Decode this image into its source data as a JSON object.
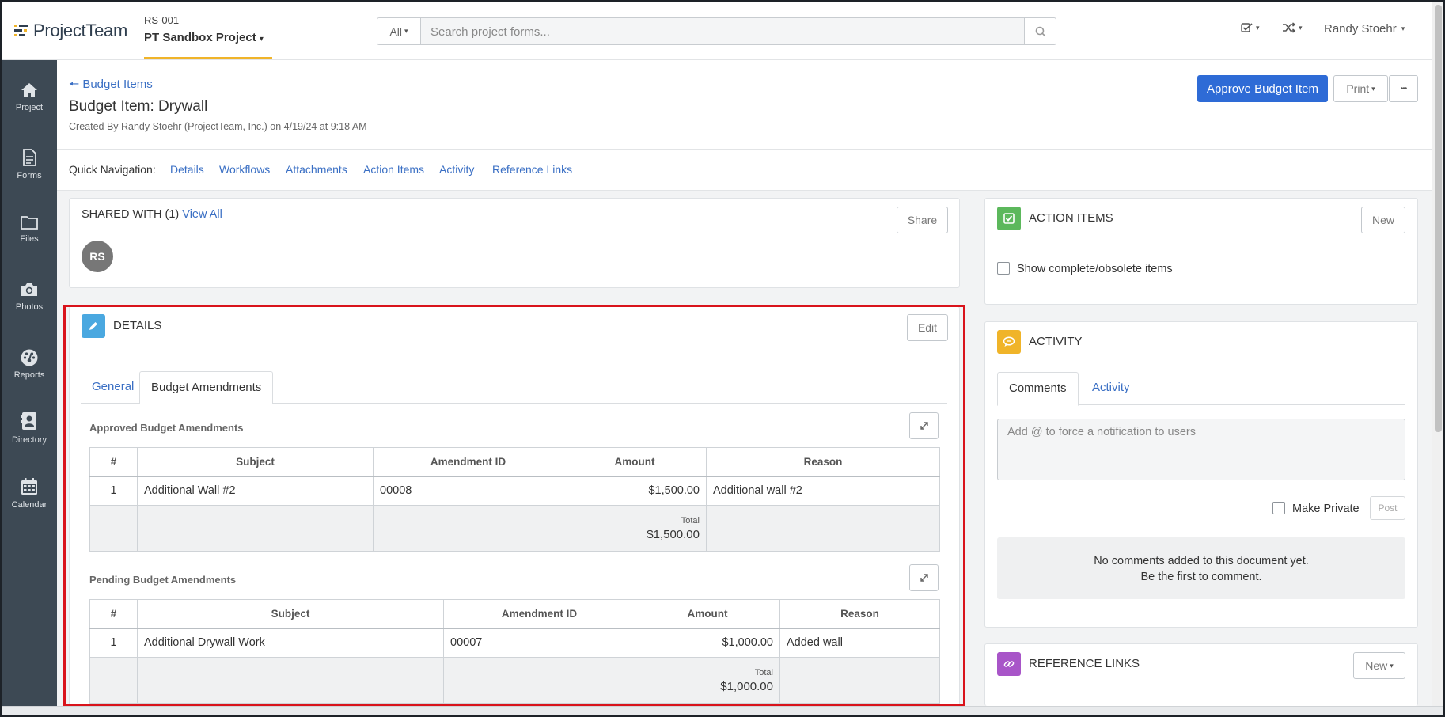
{
  "app": {
    "logo_text": "ProjectTeam",
    "project_code": "RS-001",
    "project_name": "PT Sandbox Project",
    "search_scope": "All",
    "search_placeholder": "Search project forms...",
    "user_name": "Randy Stoehr"
  },
  "sidebar": {
    "items": [
      {
        "label": "Project",
        "icon": "home-icon"
      },
      {
        "label": "Forms",
        "icon": "document-icon"
      },
      {
        "label": "Files",
        "icon": "folder-icon"
      },
      {
        "label": "Photos",
        "icon": "camera-icon"
      },
      {
        "label": "Reports",
        "icon": "dashboard-icon"
      },
      {
        "label": "Directory",
        "icon": "contact-book-icon"
      },
      {
        "label": "Calendar",
        "icon": "calendar-icon"
      }
    ]
  },
  "header": {
    "back_label": "Budget Items",
    "title": "Budget Item: Drywall",
    "created": "Created By Randy Stoehr (ProjectTeam, Inc.) on 4/19/24 at 9:18 AM",
    "approve_label": "Approve Budget Item",
    "print_label": "Print",
    "more_label": "•••"
  },
  "quicknav": {
    "label": "Quick Navigation:",
    "links": [
      "Details",
      "Workflows",
      "Attachments",
      "Action Items",
      "Activity",
      "Reference Links"
    ]
  },
  "shared": {
    "title": "SHARED WITH (1)",
    "view_all": "View All",
    "share_label": "Share",
    "avatar_initials": "RS"
  },
  "details": {
    "title": "DETAILS",
    "edit_label": "Edit",
    "tabs": [
      "General",
      "Budget Amendments"
    ],
    "columns": [
      "#",
      "Subject",
      "Amendment ID",
      "Amount",
      "Reason"
    ],
    "approved": {
      "title": "Approved Budget Amendments",
      "rows": [
        {
          "num": "1",
          "subject": "Additional Wall #2",
          "amendment_id": "00008",
          "amount": "$1,500.00",
          "reason": "Additional wall #2"
        }
      ],
      "total_label": "Total",
      "total_value": "$1,500.00"
    },
    "pending": {
      "title": "Pending Budget Amendments",
      "rows": [
        {
          "num": "1",
          "subject": "Additional Drywall Work",
          "amendment_id": "00007",
          "amount": "$1,000.00",
          "reason": "Added wall"
        }
      ],
      "total_label": "Total",
      "total_value": "$1,000.00"
    }
  },
  "action_items": {
    "title": "ACTION ITEMS",
    "new_label": "New",
    "show_complete_label": "Show complete/obsolete items"
  },
  "activity": {
    "title": "ACTIVITY",
    "tabs": [
      "Comments",
      "Activity"
    ],
    "comment_placeholder": "Add @ to force a notification to users",
    "make_private_label": "Make Private",
    "post_label": "Post",
    "empty_line1": "No comments added to this document yet.",
    "empty_line2": "Be the first to comment."
  },
  "reference_links": {
    "title": "REFERENCE LINKS",
    "new_label": "New"
  },
  "colors": {
    "primary": "#2e6bd6",
    "link": "#3a6fc4",
    "sidebar": "#3d4954",
    "highlight": "#d9131b",
    "action_items_badge": "#5cb85c",
    "activity_badge": "#f0b429",
    "reference_badge": "#a855c8",
    "details_badge": "#4aa8e0"
  }
}
